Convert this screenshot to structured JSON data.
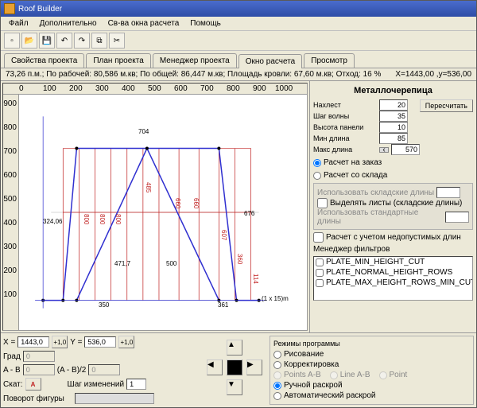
{
  "title": "Roof Builder",
  "menu": [
    "Файл",
    "Дополнительно",
    "Св-ва окна расчета",
    "Помощь"
  ],
  "tabs": [
    "Свойства проекта",
    "План проекта",
    "Менеджер проекта",
    "Окно расчета",
    "Просмотр"
  ],
  "status_left": "73,26 п.м.; По рабочей: 80,586 м.кв; По общей: 86,447 м.кв; Площадь кровли: 67,60 м.кв; Отход: 16 %",
  "status_right": "X=1443,00 ,y=536,00",
  "ruler_h": [
    "0",
    "100",
    "200",
    "300",
    "400",
    "500",
    "600",
    "700",
    "800",
    "900",
    "1000"
  ],
  "ruler_v": [
    "900",
    "800",
    "700",
    "600",
    "500",
    "400",
    "300",
    "200",
    "100"
  ],
  "side": {
    "title": "Металлочерепица",
    "params": [
      {
        "label": "Нахлест",
        "val": "20"
      },
      {
        "label": "Шаг волны",
        "val": "35"
      },
      {
        "label": "Высота панели",
        "val": "10"
      },
      {
        "label": "Мин длина",
        "val": "85"
      },
      {
        "label": "Макс длина",
        "val": "570"
      }
    ],
    "recalc": "Пересчитать",
    "r1": "Расчет на заказ",
    "r2": "Расчет со склада",
    "g1": "Использовать складские длины",
    "g2": "Выделять листы (складские длины)",
    "g3": "Использовать стандартные длины",
    "c1": "Расчет с учетом недопустимых длин",
    "fm_title": "Менеджер фильтров",
    "filters": [
      "PLATE_MIN_HEIGHT_CUT",
      "PLATE_NORMAL_HEIGHT_ROWS",
      "PLATE_MAX_HEIGHT_ROWS_MIN_CUTS"
    ]
  },
  "bottom": {
    "x": "1443,0",
    "xbtn": "+1,0",
    "y": "536,0",
    "ybtn": "+1,0",
    "grad_l": "Град",
    "grad": "0",
    "ab_l": "A - B",
    "ab": "0",
    "ab2": "(A - B)/2",
    "ab2v": "0",
    "skat_l": "Скат:",
    "skat": "A",
    "step_l": "Шаг изменений",
    "step": "1",
    "rot_l": "Поворот фигуры",
    "modes_title": "Режимы программы",
    "m1": "Рисование",
    "m2": "Корректировка",
    "m3": "Points A-B",
    "m4": "Line A-B",
    "m5": "Point",
    "m6": "Ручной раскрой",
    "m7": "Автоматический раскрой"
  },
  "chart_data": {
    "type": "diagram",
    "unit": "cm",
    "baseline_y": 100,
    "x_range": [
      0,
      1050
    ],
    "annotations": {
      "top_width": "704",
      "left_height": "324,06",
      "mid_left": "471,7",
      "mid_right": "500",
      "bottom_left": "350",
      "bottom_right": "361",
      "right_label": "676",
      "grid_note": "(1 x 15)m",
      "col_labels": [
        "800",
        "800",
        "800",
        "485",
        "660",
        "660",
        "607",
        "360",
        "114"
      ]
    },
    "outline": [
      [
        30,
        100
      ],
      [
        140,
        100
      ],
      [
        190,
        730
      ],
      [
        700,
        730
      ],
      [
        760,
        100
      ],
      [
        870,
        100
      ]
    ],
    "inner_v": [
      [
        190,
        100
      ],
      [
        450,
        730
      ],
      [
        700,
        100
      ]
    ],
    "verticals": [
      140,
      190,
      250,
      310,
      370,
      430,
      490,
      560,
      630,
      700,
      760,
      820,
      870
    ]
  }
}
